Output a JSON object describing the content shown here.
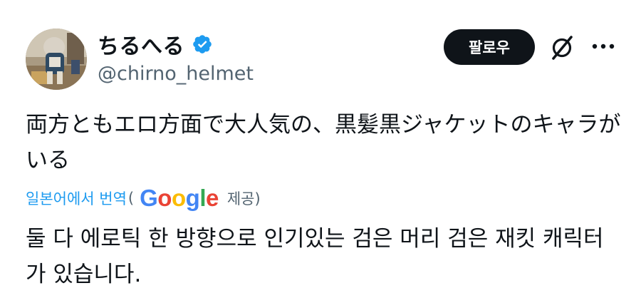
{
  "author": {
    "display_name": "ちるへる",
    "handle": "@chirno_helmet",
    "verified": true
  },
  "actions": {
    "follow_label": "팔로우"
  },
  "tweet": {
    "text": "両方ともエロ方面で大人気の、黒髪黒ジャケットのキャラがいる"
  },
  "translation": {
    "link_label": "일본어에서 번역",
    "open_paren": "(",
    "provider": {
      "G": "G",
      "o1": "o",
      "o2": "o",
      "g": "g",
      "l": "l",
      "e": "e"
    },
    "provider_suffix": "제공)",
    "text": "둘 다 에로틱 한 방향으로 인기있는 검은 머리 검은 재킷 캐릭터가 있습니다."
  },
  "colors": {
    "accent": "#1d9bf0",
    "text": "#0f1419",
    "secondary": "#536471",
    "follow_bg": "#0f1419"
  },
  "icons": {
    "verified": "verified-badge-icon",
    "grok": "grok-icon",
    "more": "more-options-icon"
  }
}
